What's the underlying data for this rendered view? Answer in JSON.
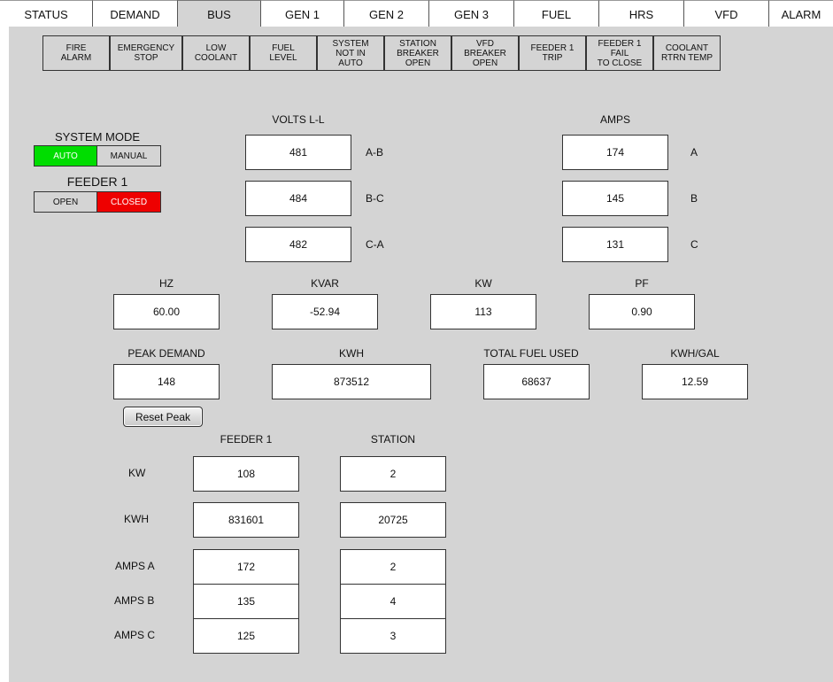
{
  "tabs": [
    "STATUS",
    "DEMAND",
    "BUS",
    "GEN 1",
    "GEN 2",
    "GEN 3",
    "FUEL",
    "HRS",
    "VFD",
    "ALARM"
  ],
  "alarms": [
    [
      "FIRE",
      "ALARM"
    ],
    [
      "EMERGENCY",
      "STOP"
    ],
    [
      "LOW",
      "COOLANT"
    ],
    [
      "FUEL",
      "LEVEL"
    ],
    [
      "SYSTEM",
      "NOT IN",
      "AUTO"
    ],
    [
      "STATION",
      "BREAKER",
      "OPEN"
    ],
    [
      "VFD",
      "BREAKER",
      "OPEN"
    ],
    [
      "FEEDER 1",
      "TRIP"
    ],
    [
      "FEEDER 1",
      "FAIL",
      "TO CLOSE"
    ],
    [
      "COOLANT",
      "RTRN TEMP"
    ]
  ],
  "system_mode": {
    "label": "SYSTEM MODE",
    "auto": "AUTO",
    "manual": "MANUAL"
  },
  "feeder1_mode": {
    "label": "FEEDER 1",
    "open": "OPEN",
    "closed": "CLOSED"
  },
  "volts": {
    "title": "VOLTS L-L",
    "ab": "481",
    "bc": "484",
    "ca": "482",
    "ab_label": "A-B",
    "bc_label": "B-C",
    "ca_label": "C-A"
  },
  "amps": {
    "title": "AMPS",
    "a": "174",
    "b": "145",
    "c": "131",
    "a_label": "A",
    "b_label": "B",
    "c_label": "C"
  },
  "hz": {
    "label": "HZ",
    "value": "60.00"
  },
  "kvar": {
    "label": "KVAR",
    "value": "-52.94"
  },
  "kw": {
    "label": "KW",
    "value": "113"
  },
  "pf": {
    "label": "PF",
    "value": "0.90"
  },
  "peak_demand": {
    "label": "PEAK DEMAND",
    "value": "148"
  },
  "kwh": {
    "label": "KWH",
    "value": "873512"
  },
  "total_fuel": {
    "label": "TOTAL FUEL USED",
    "value": "68637"
  },
  "kwh_gal": {
    "label": "KWH/GAL",
    "value": "12.59"
  },
  "reset_peak": "Reset Peak",
  "feeder_table": {
    "feeder_header": "FEEDER 1",
    "station_header": "STATION",
    "rows": [
      {
        "label": "KW",
        "feeder": "108",
        "station": "2"
      },
      {
        "label": "KWH",
        "feeder": "831601",
        "station": "20725"
      },
      {
        "label": "AMPS A",
        "feeder": "172",
        "station": "2"
      },
      {
        "label": "AMPS B",
        "feeder": "135",
        "station": "4"
      },
      {
        "label": "AMPS C",
        "feeder": "125",
        "station": "3"
      }
    ]
  },
  "colors": {
    "auto_active": "#00dd00",
    "closed_active": "#ee0000",
    "panel": "#d4d4d4"
  }
}
